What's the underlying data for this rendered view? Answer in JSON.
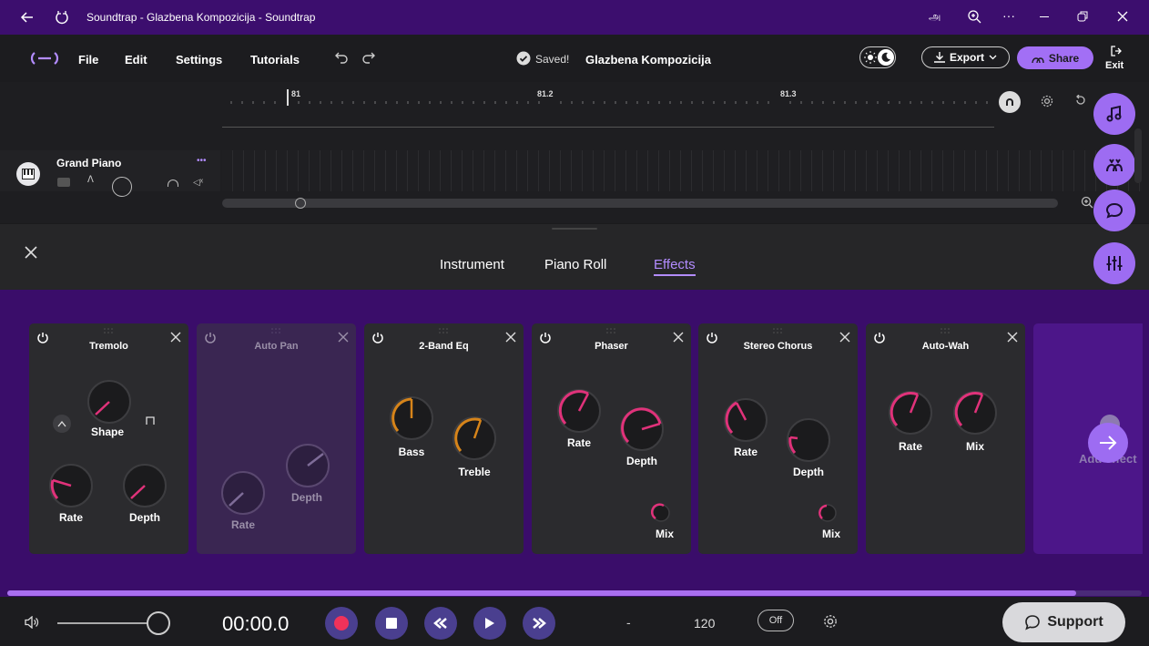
{
  "window": {
    "title": "Soundtrap - Glazbena Kompozicija - Soundtrap"
  },
  "menu": {
    "file": "File",
    "edit": "Edit",
    "settings": "Settings",
    "tutorials": "Tutorials",
    "saved": "Saved!",
    "project_title": "Glazbena Kompozicija",
    "export": "Export",
    "share": "Share",
    "exit": "Exit"
  },
  "ruler": {
    "marks": [
      "81",
      "81.2",
      "81.3"
    ]
  },
  "track": {
    "name": "Grand Piano",
    "more": "•••"
  },
  "tabs": {
    "instrument": "Instrument",
    "piano_roll": "Piano Roll",
    "effects": "Effects"
  },
  "effects": [
    {
      "title": "Tremolo",
      "enabled": true,
      "knobs": [
        "Shape",
        "Rate",
        "Depth"
      ]
    },
    {
      "title": "Auto Pan",
      "enabled": false,
      "knobs": [
        "Depth",
        "Rate"
      ]
    },
    {
      "title": "2-Band Eq",
      "enabled": true,
      "knobs": [
        "Bass",
        "Treble"
      ]
    },
    {
      "title": "Phaser",
      "enabled": true,
      "knobs": [
        "Rate",
        "Depth",
        "Mix"
      ]
    },
    {
      "title": "Stereo Chorus",
      "enabled": true,
      "knobs": [
        "Rate",
        "Depth",
        "Mix"
      ]
    },
    {
      "title": "Auto-Wah",
      "enabled": true,
      "knobs": [
        "Rate",
        "Mix"
      ]
    }
  ],
  "add_effect": "Add effect",
  "transport": {
    "time": "00:00.0",
    "dash": "-",
    "tempo": "120",
    "metronome": "Off",
    "support": "Support"
  },
  "colors": {
    "accent": "#9d6cf2",
    "knob_pink": "#e0327a",
    "knob_orange": "#d6841a",
    "record": "#f0325a"
  }
}
